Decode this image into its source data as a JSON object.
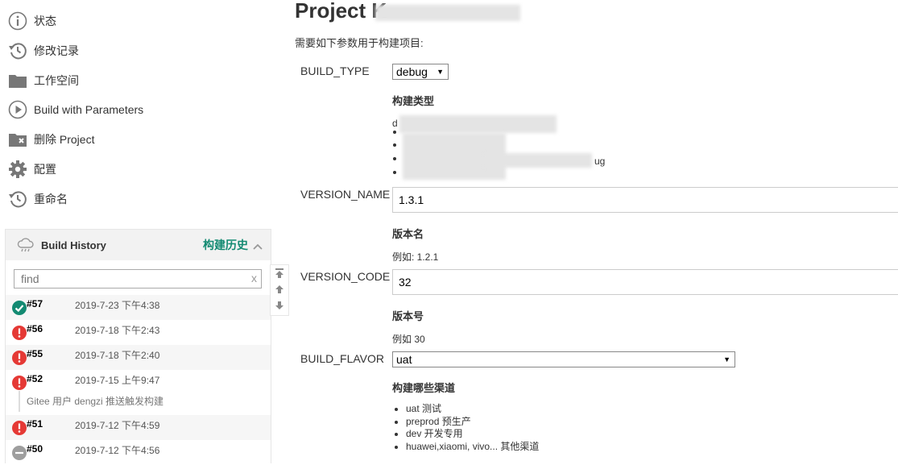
{
  "sidebar": {
    "tasks": [
      {
        "label": "状态",
        "icon": "status-icon"
      },
      {
        "label": "修改记录",
        "icon": "history-icon"
      },
      {
        "label": "工作空间",
        "icon": "folder-icon"
      },
      {
        "label": "Build with Parameters",
        "icon": "play-icon"
      },
      {
        "label": "删除 Project",
        "icon": "delete-folder-icon"
      },
      {
        "label": "配置",
        "icon": "gear-icon"
      },
      {
        "label": "重命名",
        "icon": "rename-icon"
      }
    ]
  },
  "build_history": {
    "title": "Build History",
    "trend_label": "构建历史",
    "search_placeholder": "find",
    "clear_label": "x",
    "builds": [
      {
        "number": "#57",
        "date": "2019-7-23 下午4:38",
        "status": "success"
      },
      {
        "number": "#56",
        "date": "2019-7-18 下午2:43",
        "status": "failed"
      },
      {
        "number": "#55",
        "date": "2019-7-18 下午2:40",
        "status": "failed"
      },
      {
        "number": "#52",
        "date": "2019-7-15 上午9:47",
        "status": "failed"
      },
      {
        "number": "#51",
        "date": "2019-7-12 下午4:59",
        "status": "failed"
      },
      {
        "number": "#50",
        "date": "2019-7-12 下午4:56",
        "status": "aborted"
      }
    ],
    "cause_text": "Gitee 用户 dengzi 推送触发构建"
  },
  "main": {
    "title_prefix": "Project K",
    "intro": "需要如下参数用于构建项目:",
    "params": {
      "build_type": {
        "name": "BUILD_TYPE",
        "value": "debug",
        "desc_title": "构建类型",
        "desc_frag1": "d",
        "desc_frag2": "ug"
      },
      "version_name": {
        "name": "VERSION_NAME",
        "value": "1.3.1",
        "desc_title": "版本名",
        "desc_text": "例如: 1.2.1"
      },
      "version_code": {
        "name": "VERSION_CODE",
        "value": "32",
        "desc_title": "版本号",
        "desc_text": "例如 30"
      },
      "build_flavor": {
        "name": "BUILD_FLAVOR",
        "value": "uat",
        "desc_title": "构建哪些渠道",
        "options_list": [
          "uat 测试",
          "preprod 预生产",
          "dev 开发专用",
          "huawei,xiaomi, vivo... 其他渠道"
        ]
      }
    }
  },
  "colors": {
    "success": "#138a72",
    "failed": "#e53935",
    "aborted": "#9e9e9e",
    "accent": "#138a72"
  }
}
